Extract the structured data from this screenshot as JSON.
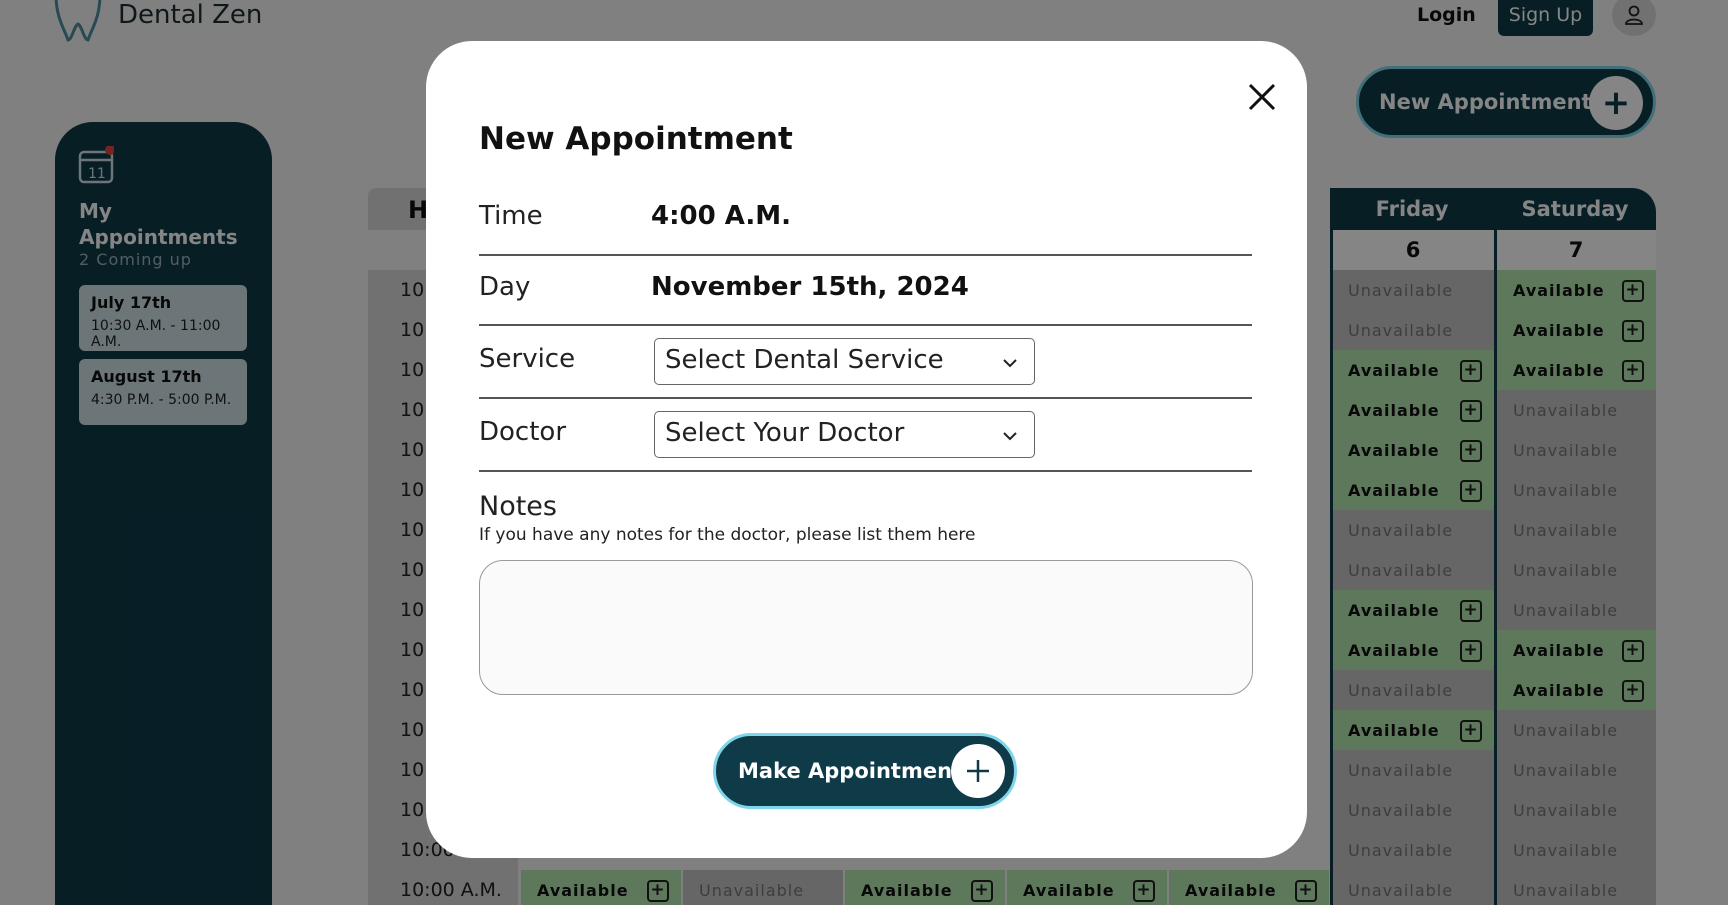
{
  "header": {
    "brand": "Dental Zen",
    "login": "Login",
    "signup": "Sign Up"
  },
  "new_appointment_button": "New Appointment",
  "sidebar": {
    "title_line1": "My",
    "title_line2": "Appointments",
    "subtitle": "2 Coming up",
    "appointments": [
      {
        "date": "July 17th",
        "time": "10:30 A.M. - 11:00 A.M."
      },
      {
        "date": "August 17th",
        "time": "4:30 P.M. - 5:00 P.M."
      }
    ]
  },
  "schedule": {
    "hour_header": "H",
    "days": [
      {
        "name": "Friday",
        "num": "6"
      },
      {
        "name": "Saturday",
        "num": "7"
      }
    ],
    "hour_labels": [
      "10:",
      "10:",
      "10:",
      "10:",
      "10:",
      "10:",
      "10:",
      "10:",
      "10:",
      "10:",
      "10:",
      "10:",
      "10:",
      "10:",
      "10:00 A.M.",
      "10:00 A.M."
    ],
    "friday": [
      "Unavailable",
      "Unavailable",
      "Available",
      "Available",
      "Available",
      "Available",
      "Unavailable",
      "Unavailable",
      "Available",
      "Available",
      "Unavailable",
      "Available",
      "Unavailable",
      "Unavailable",
      "Unavailable",
      "Unavailable"
    ],
    "saturday": [
      "Available",
      "Available",
      "Available",
      "Unavailable",
      "Unavailable",
      "Unavailable",
      "Unavailable",
      "Unavailable",
      "Unavailable",
      "Available",
      "Available",
      "Unavailable",
      "Unavailable",
      "Unavailable",
      "Unavailable",
      "Unavailable"
    ],
    "bottom_row": [
      "Available",
      "Unavailable",
      "Available",
      "Available",
      "Available",
      "Unavailable"
    ]
  },
  "modal": {
    "title": "New Appointment",
    "time_label": "Time",
    "time_value": "4:00 A.M.",
    "day_label": "Day",
    "day_value": "November 15th, 2024",
    "service_label": "Service",
    "service_value": "Select Dental Service",
    "doctor_label": "Doctor",
    "doctor_value": "Select Your Doctor",
    "notes_label": "Notes",
    "notes_hint": "If you have any notes for the doctor, please list them here",
    "notes_value": "",
    "submit": "Make Appointment"
  },
  "colors": {
    "brand_dark": "#0f3a48",
    "accent_glow": "#7fd6ea",
    "available": "#b5e6b0",
    "unavailable": "#c4c4c4"
  }
}
